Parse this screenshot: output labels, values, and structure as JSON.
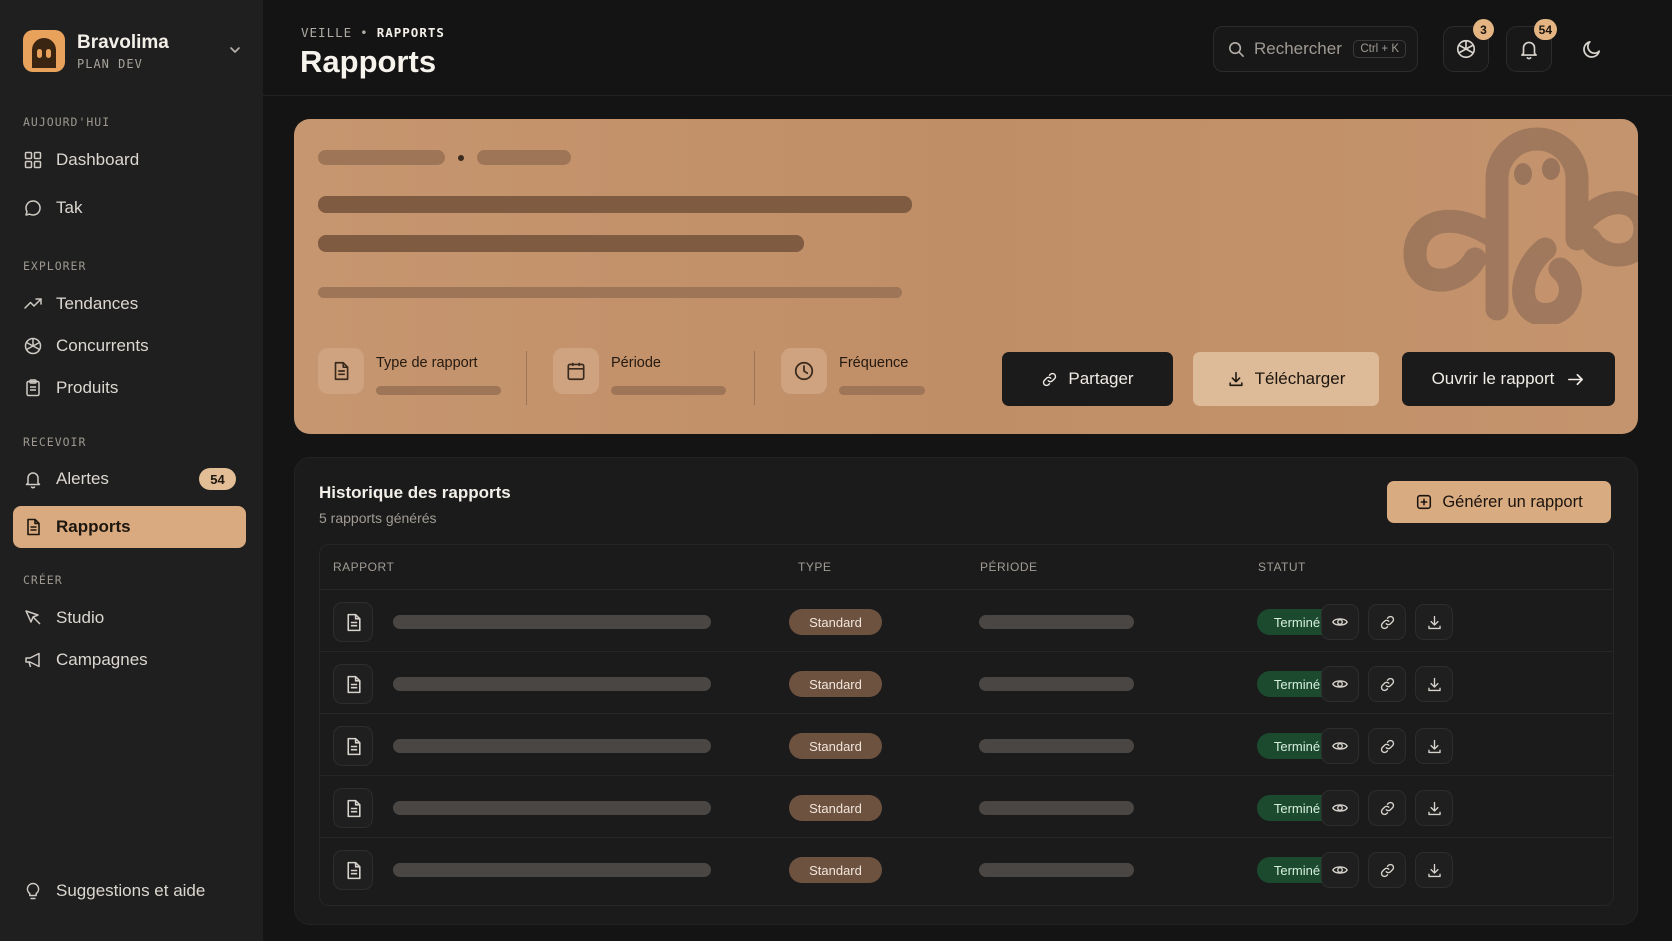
{
  "brand": {
    "name": "Bravolima",
    "plan": "PLAN DEV"
  },
  "sidebar": {
    "sections": [
      {
        "label": "AUJOURD'HUI",
        "items": [
          {
            "label": "Dashboard",
            "icon": "grid-icon"
          },
          {
            "label": "Tak",
            "icon": "chat-icon"
          }
        ]
      },
      {
        "label": "EXPLORER",
        "items": [
          {
            "label": "Tendances",
            "icon": "trending-icon"
          },
          {
            "label": "Concurrents",
            "icon": "aperture-icon"
          },
          {
            "label": "Produits",
            "icon": "clipboard-icon"
          }
        ]
      },
      {
        "label": "RECEVOIR",
        "items": [
          {
            "label": "Alertes",
            "icon": "bell-icon",
            "badge": "54"
          },
          {
            "label": "Rapports",
            "icon": "report-icon",
            "active": true
          }
        ]
      },
      {
        "label": "CRÉER",
        "items": [
          {
            "label": "Studio",
            "icon": "studio-icon"
          },
          {
            "label": "Campagnes",
            "icon": "megaphone-icon"
          }
        ]
      }
    ],
    "footer": {
      "label": "Suggestions et aide",
      "icon": "lightbulb-icon"
    }
  },
  "header": {
    "breadcrumb": {
      "parent": "VEILLE",
      "separator": "•",
      "current": "RAPPORTS"
    },
    "title": "Rapports",
    "search": {
      "placeholder": "Rechercher",
      "shortcut": "Ctrl + K"
    },
    "competitors_count": "3",
    "notifications_count": "54"
  },
  "hero": {
    "meta": [
      {
        "label": "Type de rapport",
        "icon": "document-icon"
      },
      {
        "label": "Période",
        "icon": "calendar-icon"
      },
      {
        "label": "Fréquence",
        "icon": "clock-icon"
      }
    ],
    "buttons": {
      "share": "Partager",
      "download": "Télécharger",
      "open": "Ouvrir le rapport"
    }
  },
  "history": {
    "title": "Historique des rapports",
    "subtitle": "5 rapports générés",
    "generate_label": "Générer un rapport",
    "columns": {
      "report": "RAPPORT",
      "type": "TYPE",
      "period": "PÉRIODE",
      "status": "STATUT"
    },
    "rows": [
      {
        "type": "Standard",
        "status": "Terminé"
      },
      {
        "type": "Standard",
        "status": "Terminé"
      },
      {
        "type": "Standard",
        "status": "Terminé"
      },
      {
        "type": "Standard",
        "status": "Terminé"
      },
      {
        "type": "Standard",
        "status": "Terminé"
      }
    ]
  },
  "colors": {
    "accent": "#d9ab80",
    "hero": "#c69670",
    "success": "#1c4a2f",
    "background": "#141414",
    "sidebar": "#1f1f1f"
  }
}
